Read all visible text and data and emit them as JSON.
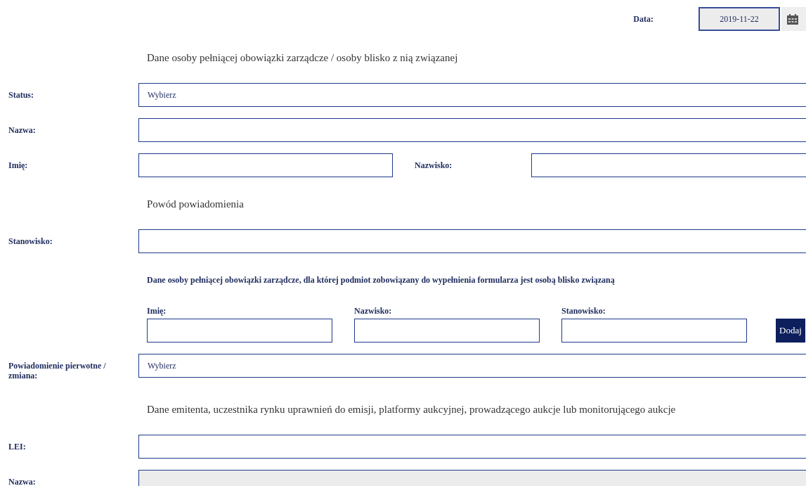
{
  "date": {
    "label": "Data:",
    "value": "2019-11-22",
    "disabled": true
  },
  "rows": [
    {
      "kind": "heading",
      "text": "Dane osoby pełniącej obowiązki zarządcze / osoby blisko z nią związanej"
    },
    {
      "kind": "select",
      "label": "Status:",
      "value": "Wybierz"
    },
    {
      "kind": "input",
      "label": "Nazwa:",
      "disabled": false
    },
    {
      "kind": "pair",
      "fields": [
        {
          "label": "Imię:",
          "disabled": false
        },
        {
          "label": "Nazwisko:",
          "disabled": false
        }
      ]
    },
    {
      "kind": "heading",
      "text": "Powód powiadomienia"
    },
    {
      "kind": "input",
      "label": "Stanowisko:",
      "disabled": false
    },
    {
      "kind": "subheading",
      "text": "Dane osoby pełniącej obowiązki zarządcze, dla której podmiot zobowiązany do wypełnienia formularza jest osobą blisko związaną"
    },
    {
      "kind": "group",
      "fields": [
        {
          "label": "Imię:",
          "disabled": false
        },
        {
          "label": "Nazwisko:",
          "disabled": false
        },
        {
          "label": "Stanowisko:",
          "disabled": false
        }
      ],
      "button": "Dodaj"
    },
    {
      "kind": "select",
      "label": "Powiadomienie pierwotne / zmiana:",
      "value": "Wybierz"
    },
    {
      "kind": "heading",
      "text": "Dane emitenta, uczestnika rynku uprawnień do emisji, platformy aukcyjnej, prowadzącego aukcje lub monitorującego aukcje"
    },
    {
      "kind": "input",
      "label": "LEI:",
      "disabled": false
    },
    {
      "kind": "input",
      "label": "Nazwa:",
      "disabled": true
    }
  ]
}
